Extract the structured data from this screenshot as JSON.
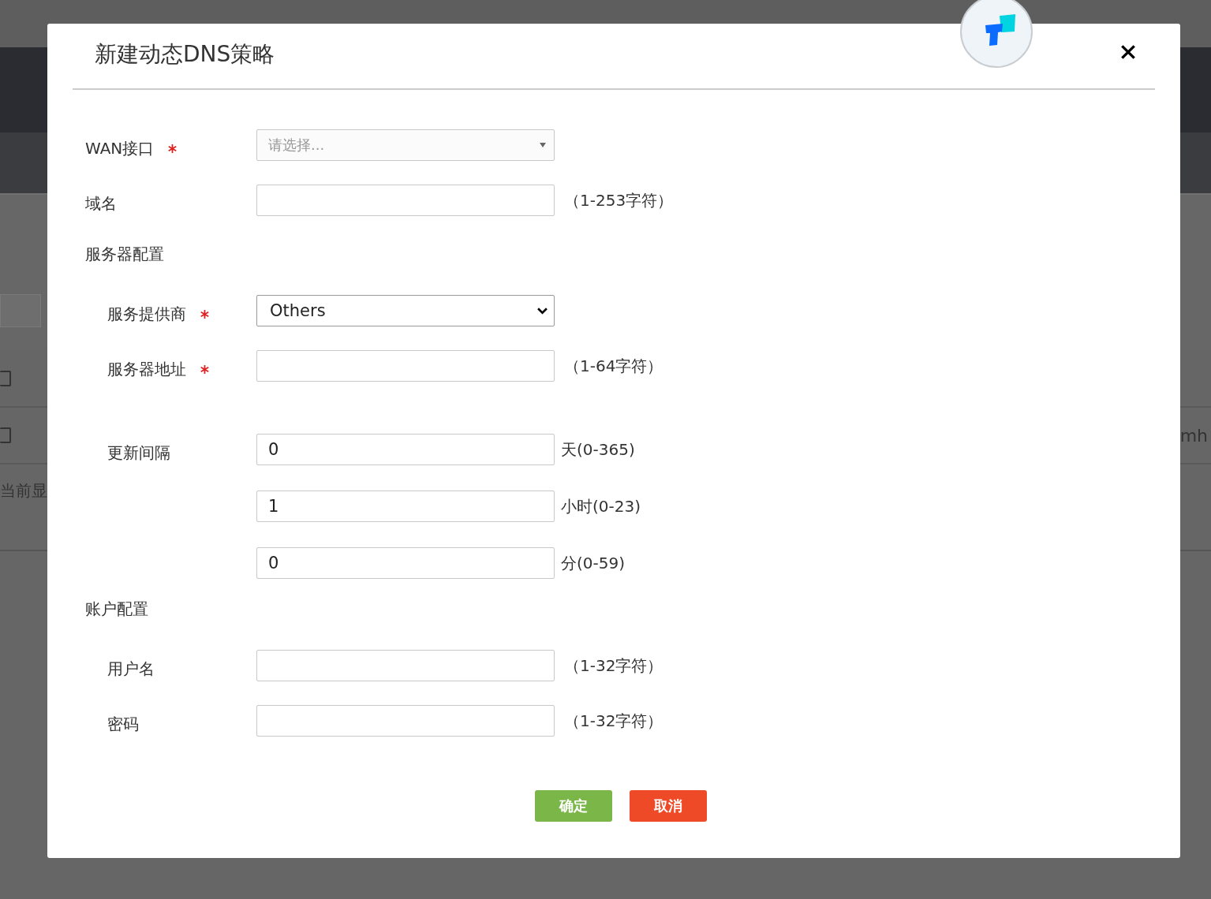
{
  "backdrop": {
    "rows": [
      {
        "checked": false
      },
      {
        "checked": false
      }
    ],
    "footer": "当前显",
    "cell": "mh"
  },
  "dialog": {
    "title": "新建动态DNS策略",
    "rows": [
      {
        "kind": "select",
        "label": "WAN接口",
        "required": true,
        "placeholder": "请选择..."
      },
      {
        "kind": "text",
        "label": "域名",
        "required": false,
        "hint": "（1-253字符）"
      },
      {
        "kind": "section",
        "label": "服务器配置",
        "children": [
          {
            "kind": "dropdown",
            "label": "服务提供商",
            "required": true,
            "value": "Others"
          },
          {
            "kind": "text",
            "label": "服务器地址",
            "required": true,
            "hint": "（1-64字符）"
          },
          {
            "kind": "multi",
            "label": "更新间隔",
            "required": false,
            "inputs": [
              {
                "value": "0",
                "unit": "天(0-365)"
              },
              {
                "value": "1",
                "unit": "小时(0-23)"
              },
              {
                "value": "0",
                "unit": "分(0-59)"
              }
            ]
          }
        ]
      },
      {
        "kind": "section",
        "label": "账户配置",
        "children": [
          {
            "kind": "text",
            "label": "用户名",
            "required": false,
            "hint": "（1-32字符）"
          },
          {
            "kind": "text",
            "label": "密码",
            "required": false,
            "hint": "（1-32字符）"
          }
        ]
      }
    ],
    "buttons": [
      {
        "label": "确定",
        "kind": "confirm"
      },
      {
        "label": "取消",
        "kind": "cancel"
      }
    ]
  }
}
